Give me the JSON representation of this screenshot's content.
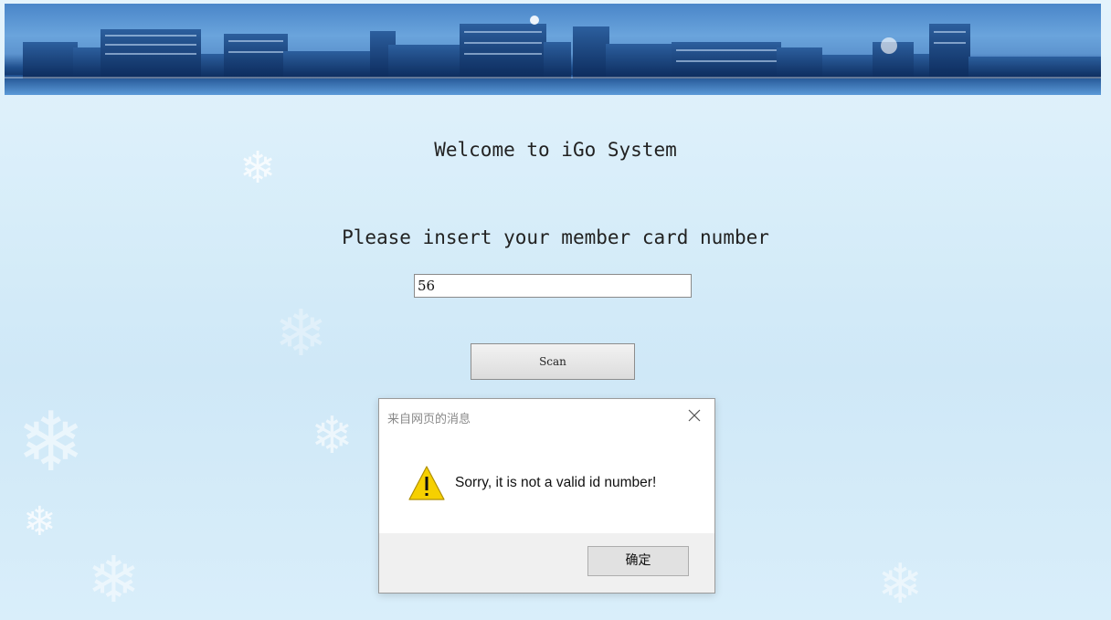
{
  "page": {
    "welcome": "Welcome to iGo System",
    "prompt": "Please insert your member card number",
    "card_input_value": "56",
    "scan_label": "Scan"
  },
  "dialog": {
    "title": "来自网页的消息",
    "message": "Sorry, it is not a valid id number!",
    "ok_label": "确定",
    "icon": "warning-icon",
    "close_icon": "close-icon"
  },
  "colors": {
    "background": "#d7edf9",
    "banner_sky": "#5d94cf",
    "warning_yellow": "#f6d000",
    "dialog_footer": "#f0f0f0"
  },
  "icons": {
    "banner": "city-skyline-banner",
    "decor": "snowflake-icon"
  }
}
